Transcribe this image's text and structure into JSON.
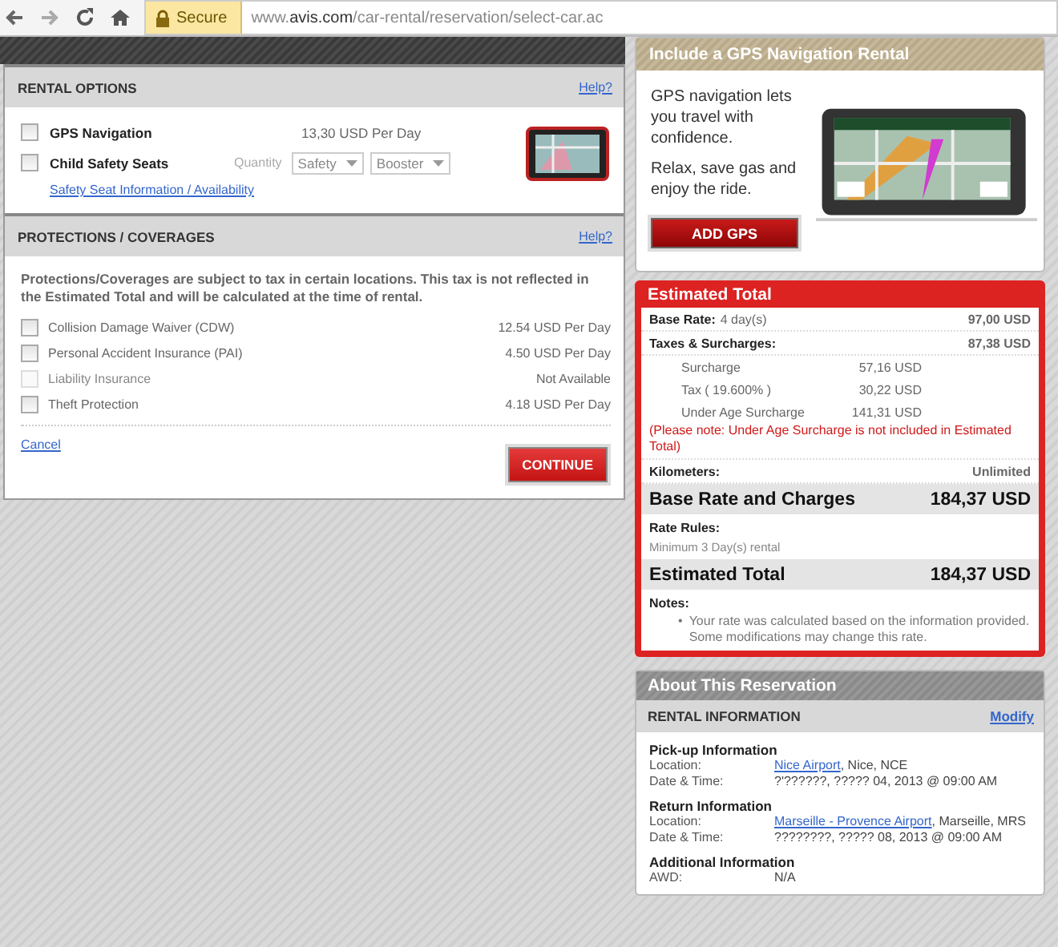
{
  "browser": {
    "secure_label": "Secure",
    "url": "www.**avis.com**/car-rental/reservation/select-car.ac"
  },
  "rental_options": {
    "title": "RENTAL OPTIONS",
    "help": "Help?",
    "items": [
      {
        "kind": "price",
        "label": "GPS Navigation",
        "checked": false,
        "price": "13,30 USD Per Day"
      },
      {
        "kind": "quantity",
        "label": "Child Safety Seats",
        "checked": false,
        "quantity_label": "Quantity",
        "selects": [
          "Safety",
          "Booster"
        ]
      }
    ],
    "link": "Safety Seat Information / Availability"
  },
  "protections": {
    "title": "PROTECTIONS / COVERAGES",
    "help": "Help?",
    "note": "Protections/Coverages are subject to tax in certain locations. This tax is not reflected in the Estimated Total and will be calculated at the time of rental.",
    "items": [
      {
        "label": "Collision Damage Waiver (CDW)",
        "price": "12.54 USD Per Day",
        "checked": false,
        "disabled": false
      },
      {
        "label": "Personal Accident Insurance (PAI)",
        "price": "4.50 USD Per Day",
        "checked": false,
        "disabled": false
      },
      {
        "label": "Liability Insurance",
        "price": "Not Available",
        "checked": false,
        "disabled": true
      },
      {
        "label": "Theft Protection",
        "price": "4.18 USD Per Day",
        "checked": false,
        "disabled": false
      }
    ],
    "cancel": "Cancel",
    "continue": "CONTINUE"
  },
  "gps_promo": {
    "title": "Include a GPS Navigation Rental",
    "lines": [
      "GPS navigation lets you travel with confidence.",
      "Relax, save gas and enjoy the ride."
    ],
    "button": "ADD GPS"
  },
  "estimated_total": {
    "title": "Estimated Total",
    "rows": [
      {
        "kind": "line",
        "label": "Base Rate:",
        "detail": "4 day(s)",
        "value": "97,00 USD"
      },
      {
        "kind": "line",
        "label": "Taxes & Surcharges:",
        "value": "87,38 USD"
      },
      {
        "kind": "sub",
        "label": "Surcharge",
        "value": "57,16 USD"
      },
      {
        "kind": "sub",
        "label": "Tax ( 19.600% )",
        "value": "30,22 USD"
      },
      {
        "kind": "sub",
        "label": "Under Age Surcharge",
        "value": "141,31 USD"
      },
      {
        "kind": "warning",
        "text": "(Please note: Under Age Surcharge is not included in Estimated Total)"
      },
      {
        "kind": "line",
        "label": "Kilometers:",
        "value": "Unlimited"
      },
      {
        "kind": "big",
        "label": "Base Rate and Charges",
        "value": "184,37 USD"
      },
      {
        "kind": "block",
        "label": "Rate Rules:",
        "text": "Minimum 3 Day(s) rental"
      },
      {
        "kind": "big",
        "label": "Estimated Total",
        "value": "184,37 USD"
      },
      {
        "kind": "notes",
        "label": "Notes:",
        "bullet": "•",
        "text": "Your rate was calculated based on the information provided. Some modifications may change this rate."
      }
    ]
  },
  "reservation": {
    "title": "About This Reservation",
    "section": "RENTAL INFORMATION",
    "modify": "Modify",
    "groups": [
      {
        "title": "Pick-up Information",
        "fields": [
          {
            "label": "Location:",
            "link": "Nice Airport",
            "rest": ", Nice, NCE"
          },
          {
            "label": "Date & Time:",
            "value": "?'??????, ????? 04, 2013 @ 09:00 AM"
          }
        ]
      },
      {
        "title": "Return Information",
        "fields": [
          {
            "label": "Location:",
            "link": "Marseille - Provence Airport",
            "rest": ", Marseille, MRS"
          },
          {
            "label": "Date & Time:",
            "value": "????????, ????? 08, 2013 @ 09:00 AM"
          }
        ]
      },
      {
        "title": "Additional Information",
        "fields": [
          {
            "label": "AWD:",
            "value": "N/A"
          }
        ]
      }
    ]
  }
}
